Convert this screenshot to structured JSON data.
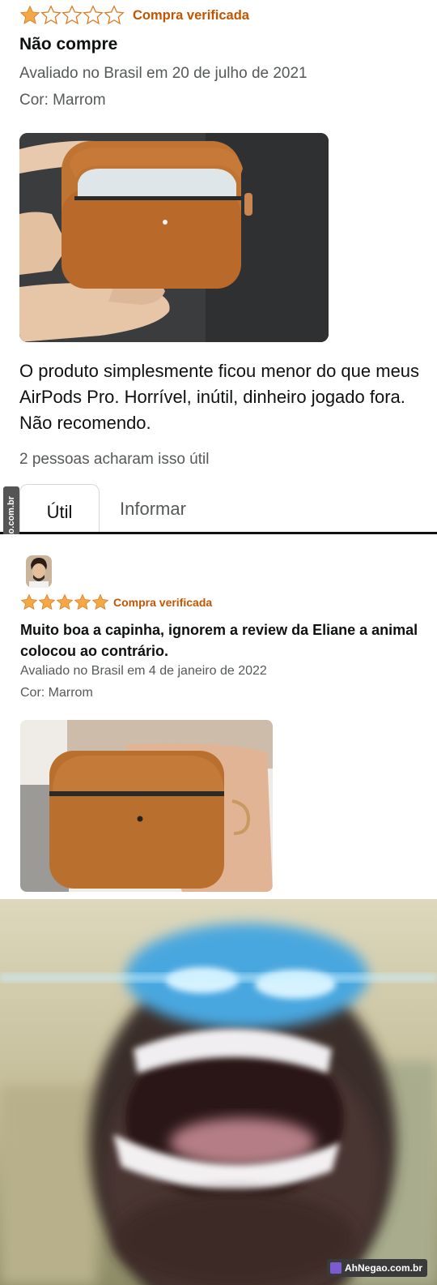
{
  "review1": {
    "rating": 1,
    "max_rating": 5,
    "verified_label": "Compra verificada",
    "title": "Não compre",
    "meta": "Avaliado no Brasil em 20 de julho de 2021",
    "color": "Cor: Marrom",
    "body": "O produto simplesmente ficou menor do que meus AirPods Pro. Horrível, inútil, dinheiro jogado fora. Não recomendo.",
    "helpful_count_text": "2 pessoas acharam isso útil",
    "helpful_button": "Útil",
    "report_button": "Informar"
  },
  "review2": {
    "rating": 5,
    "max_rating": 5,
    "verified_label": "Compra verificada",
    "title": "Muito boa a capinha, ignorem a review da Eliane a animal colocou ao contrário.",
    "meta": "Avaliado no Brasil em 4 de janeiro de 2022",
    "color": "Cor: Marrom"
  },
  "watermark": {
    "side_text": "AhNegao.com.br",
    "bottom_text": "AhNegao.com.br"
  },
  "colors": {
    "star": "#f3a847",
    "verified": "#c45500",
    "text": "#0f1111",
    "muted": "#565959"
  }
}
